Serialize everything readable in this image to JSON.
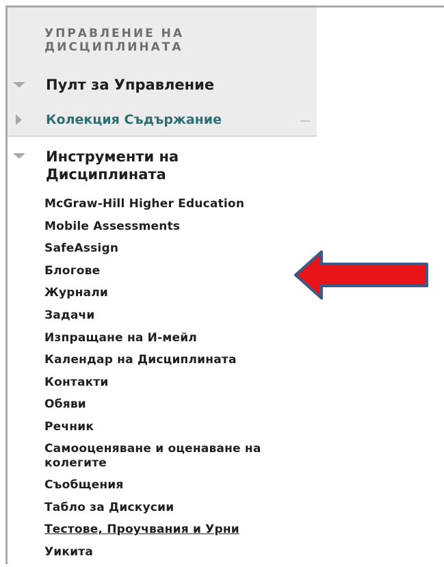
{
  "menu": {
    "section_header": "УПРАВЛЕНИЕ НА ДИСЦИПЛИНАТА",
    "control_panel_label": "Пулт за Управление",
    "content_collection_label": "Колекция Съдържание",
    "course_tools_label": "Инструменти на Дисциплината",
    "tools": [
      "McGraw-Hill Higher Education",
      "Mobile Assessments",
      "SafeAssign",
      "Блогове",
      "Журнали",
      "Задачи",
      "Изпращане на И-мейл",
      "Календар на Дисциплината",
      "Контакти",
      "Обяви",
      "Речник",
      "Самооценяване и оценаване на колегите",
      "Съобщения",
      "Табло за Дискусии",
      "Тестове, Проучвания и Урни",
      "Уикита"
    ]
  },
  "colors": {
    "panel_background": "#ececec",
    "link_teal": "#2e6f74",
    "arrow_fill": "#e8141a",
    "arrow_outline": "#3b5a86"
  },
  "icons": {
    "control_panel_toggle": "triangle-down-icon",
    "content_collection_toggle": "triangle-right-icon",
    "course_tools_toggle": "triangle-down-icon",
    "annotation": "left-arrow-icon"
  }
}
